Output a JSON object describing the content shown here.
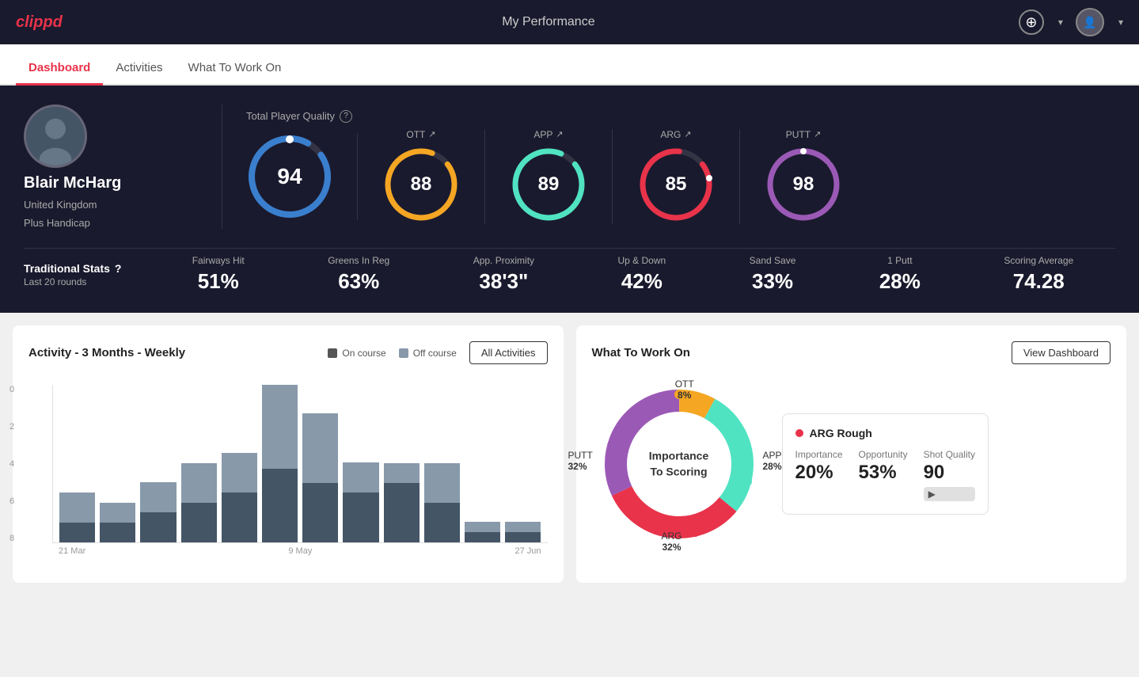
{
  "app": {
    "logo_text": "clippd",
    "nav_title": "My Performance",
    "add_icon": "⊕",
    "user_avatar": "👤"
  },
  "tabs": [
    {
      "id": "dashboard",
      "label": "Dashboard",
      "active": true
    },
    {
      "id": "activities",
      "label": "Activities",
      "active": false
    },
    {
      "id": "what-to-work-on",
      "label": "What To Work On",
      "active": false
    }
  ],
  "player": {
    "name": "Blair McHarg",
    "country": "United Kingdom",
    "handicap": "Plus Handicap"
  },
  "total_quality": {
    "label": "Total Player Quality",
    "value": 94,
    "color": "#3a7fce"
  },
  "gauges": [
    {
      "id": "ott",
      "label": "OTT",
      "value": 88,
      "color": "#f5a623"
    },
    {
      "id": "app",
      "label": "APP",
      "value": 89,
      "color": "#50e3c2"
    },
    {
      "id": "arg",
      "label": "ARG",
      "value": 85,
      "color": "#e8334a"
    },
    {
      "id": "putt",
      "label": "PUTT",
      "value": 98,
      "color": "#9b59b6"
    }
  ],
  "traditional_stats": {
    "title": "Traditional Stats",
    "subtitle": "Last 20 rounds",
    "items": [
      {
        "name": "Fairways Hit",
        "value": "51%"
      },
      {
        "name": "Greens In Reg",
        "value": "63%"
      },
      {
        "name": "App. Proximity",
        "value": "38'3\""
      },
      {
        "name": "Up & Down",
        "value": "42%"
      },
      {
        "name": "Sand Save",
        "value": "33%"
      },
      {
        "name": "1 Putt",
        "value": "28%"
      },
      {
        "name": "Scoring Average",
        "value": "74.28"
      }
    ]
  },
  "activity_chart": {
    "title": "Activity - 3 Months - Weekly",
    "legend": [
      {
        "label": "On course",
        "color": "#555"
      },
      {
        "label": "Off course",
        "color": "#8899aa"
      }
    ],
    "all_activities_btn": "All Activities",
    "y_labels": [
      "0",
      "2",
      "4",
      "6",
      "8"
    ],
    "x_labels": [
      "21 Mar",
      "9 May",
      "27 Jun"
    ],
    "bars": [
      {
        "on": 1,
        "off": 1.5
      },
      {
        "on": 1,
        "off": 1
      },
      {
        "on": 1.5,
        "off": 1.5
      },
      {
        "on": 2,
        "off": 2
      },
      {
        "on": 2.5,
        "off": 2
      },
      {
        "on": 4,
        "off": 4.5
      },
      {
        "on": 3,
        "off": 3.5
      },
      {
        "on": 2.5,
        "off": 1.5
      },
      {
        "on": 3,
        "off": 1
      },
      {
        "on": 2,
        "off": 2
      },
      {
        "on": 0.5,
        "off": 0.5
      },
      {
        "on": 0.5,
        "off": 0.5
      }
    ]
  },
  "what_to_work_on": {
    "title": "What To Work On",
    "view_dashboard_btn": "View Dashboard",
    "donut_center": "Importance\nTo Scoring",
    "segments": [
      {
        "label": "OTT",
        "percent": "8%",
        "color": "#f5a623"
      },
      {
        "label": "APP",
        "percent": "28%",
        "color": "#50e3c2"
      },
      {
        "label": "ARG",
        "percent": "32%",
        "color": "#e8334a"
      },
      {
        "label": "PUTT",
        "percent": "32%",
        "color": "#9b59b6"
      }
    ],
    "info_card": {
      "category": "ARG Rough",
      "dot_color": "#e8334a",
      "stats": [
        {
          "label": "Importance",
          "value": "20%"
        },
        {
          "label": "Opportunity",
          "value": "53%"
        },
        {
          "label": "Shot Quality",
          "value": "90"
        }
      ]
    }
  }
}
